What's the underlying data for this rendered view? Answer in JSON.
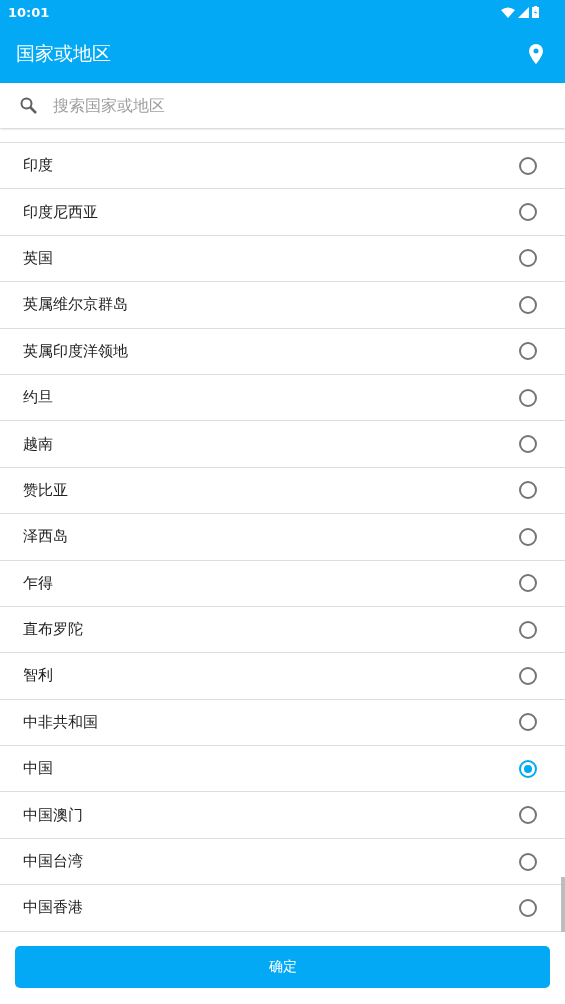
{
  "status_bar": {
    "time": "10:01"
  },
  "app_bar": {
    "title": "国家或地区"
  },
  "search": {
    "placeholder": "搜索国家或地区"
  },
  "countries": [
    {
      "name": "印度",
      "selected": false
    },
    {
      "name": "印度尼西亚",
      "selected": false
    },
    {
      "name": "英国",
      "selected": false
    },
    {
      "name": "英属维尔京群岛",
      "selected": false
    },
    {
      "name": "英属印度洋领地",
      "selected": false
    },
    {
      "name": "约旦",
      "selected": false
    },
    {
      "name": "越南",
      "selected": false
    },
    {
      "name": "赞比亚",
      "selected": false
    },
    {
      "name": "泽西岛",
      "selected": false
    },
    {
      "name": "乍得",
      "selected": false
    },
    {
      "name": "直布罗陀",
      "selected": false
    },
    {
      "name": "智利",
      "selected": false
    },
    {
      "name": "中非共和国",
      "selected": false
    },
    {
      "name": "中国",
      "selected": true
    },
    {
      "name": "中国澳门",
      "selected": false
    },
    {
      "name": "中国台湾",
      "selected": false
    },
    {
      "name": "中国香港",
      "selected": false
    }
  ],
  "confirm_button": "确定"
}
